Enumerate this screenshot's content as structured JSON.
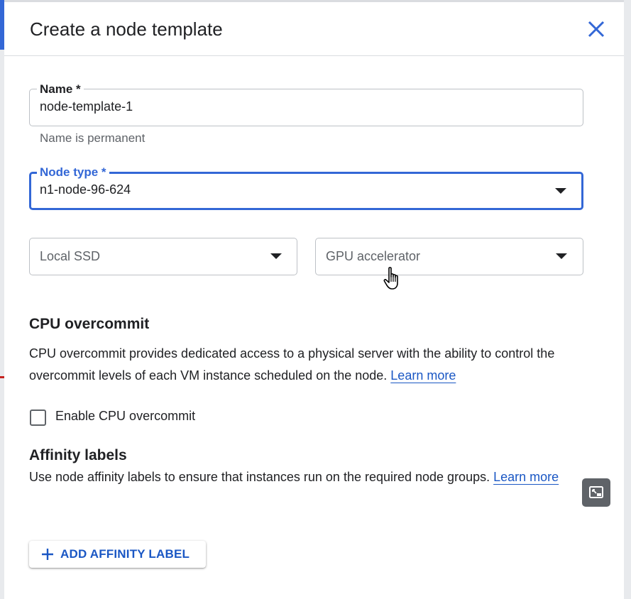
{
  "dialog": {
    "title": "Create a node template",
    "close_icon": "close-icon"
  },
  "form": {
    "name": {
      "label": "Name *",
      "value": "node-template-1",
      "hint": "Name is permanent"
    },
    "node_type": {
      "label": "Node type *",
      "value": "n1-node-96-624",
      "accent_color": "#3367d6"
    },
    "local_ssd": {
      "placeholder": "Local SSD"
    },
    "gpu_accelerator": {
      "placeholder": "GPU accelerator"
    }
  },
  "cpu_overcommit": {
    "title": "CPU overcommit",
    "description": "CPU overcommit provides dedicated access to a physical server with the ability to control the overcommit levels of each VM instance scheduled on the node.",
    "learn_more": "Learn more",
    "checkbox_label": "Enable CPU overcommit",
    "checked": false
  },
  "affinity_labels": {
    "title": "Affinity labels",
    "description": "Use node affinity labels to ensure that instances run on the required node groups.",
    "learn_more": "Learn more",
    "add_button": "ADD AFFINITY LABEL"
  },
  "colors": {
    "link": "#1a57c4",
    "focus_border": "#3367d6"
  }
}
